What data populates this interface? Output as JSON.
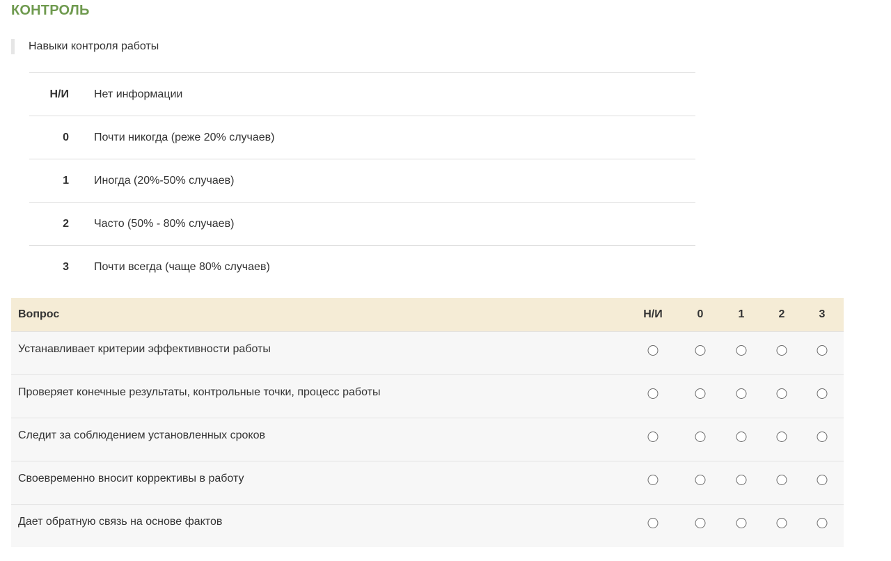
{
  "section": {
    "title": "КОНТРОЛЬ",
    "subtitle": "Навыки контроля работы"
  },
  "legend": [
    {
      "code": "Н/И",
      "desc": "Нет информации"
    },
    {
      "code": "0",
      "desc": "Почти никогда (реже 20% случаев)"
    },
    {
      "code": "1",
      "desc": "Иногда (20%-50% случаев)"
    },
    {
      "code": "2",
      "desc": "Часто (50% - 80% случаев)"
    },
    {
      "code": "3",
      "desc": "Почти всегда (чаще 80% случаев)"
    }
  ],
  "grid": {
    "header": {
      "question": "Вопрос",
      "options": [
        "Н/И",
        "0",
        "1",
        "2",
        "3"
      ]
    },
    "rows": [
      {
        "question": "Устанавливает критерии эффективности работы"
      },
      {
        "question": "Проверяет конечные результаты, контрольные точки, процесс работы"
      },
      {
        "question": "Следит за соблюдением установленных сроков"
      },
      {
        "question": "Своевременно вносит коррективы в работу"
      },
      {
        "question": "Дает обратную связь на основе фактов"
      }
    ]
  }
}
